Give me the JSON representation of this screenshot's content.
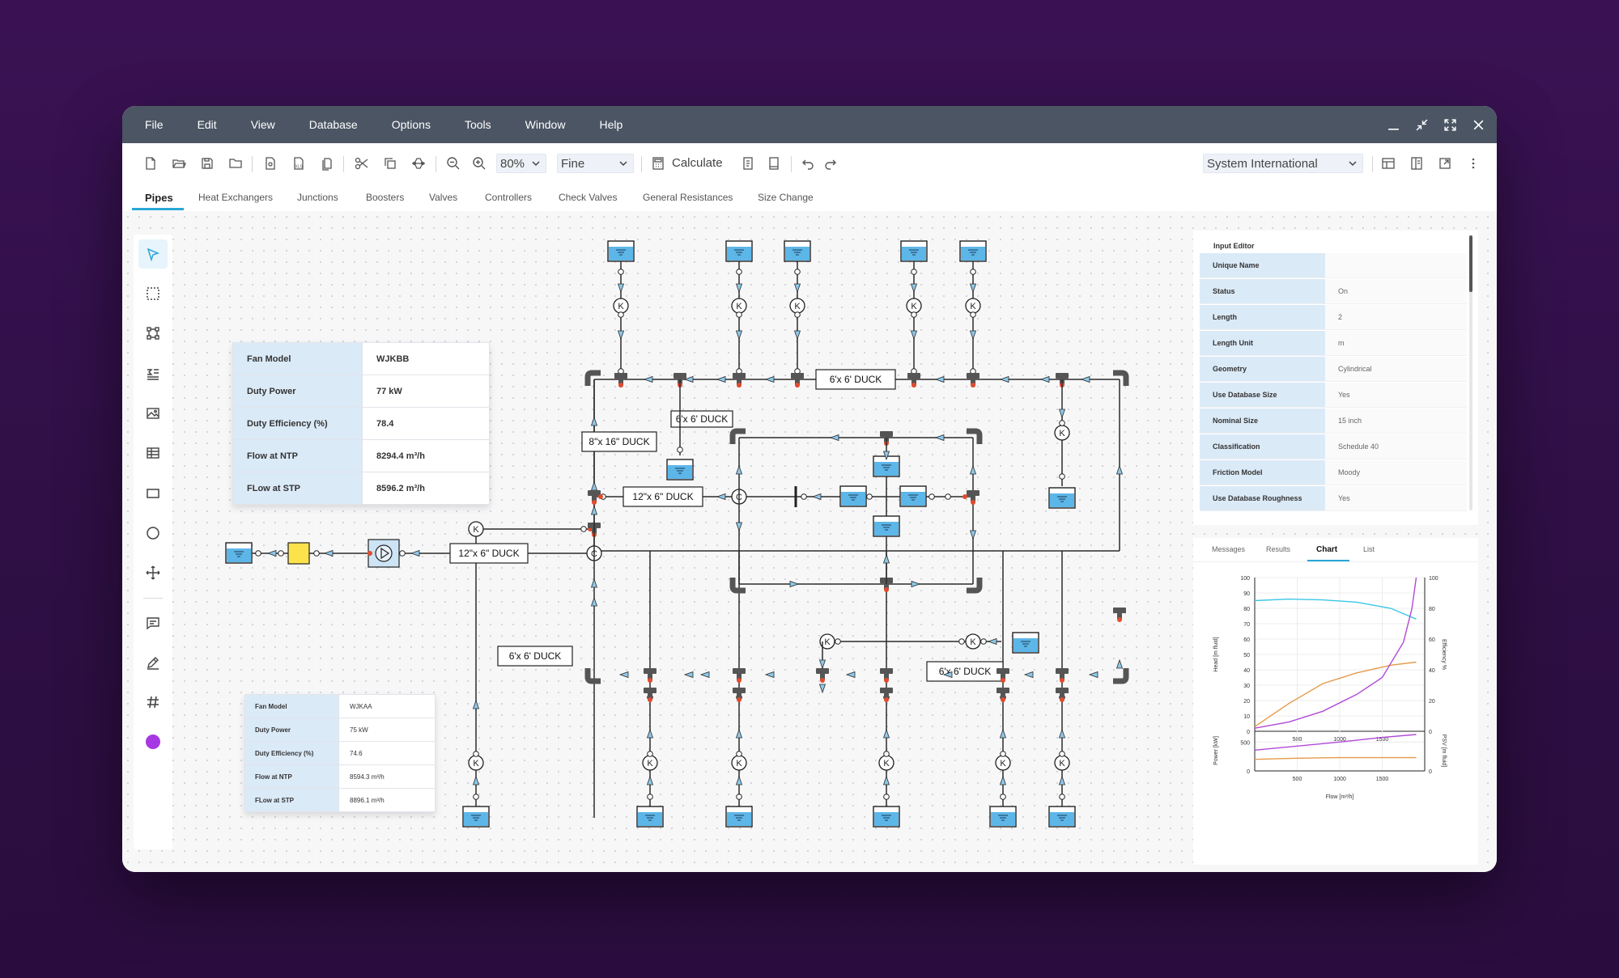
{
  "menu": [
    "File",
    "Edit",
    "View",
    "Database",
    "Options",
    "Tools",
    "Window",
    "Help"
  ],
  "toolbar": {
    "zoom": "80%",
    "mesh": "Fine",
    "calculate_label": "Calculate",
    "units": "System International"
  },
  "tabs": [
    "Pipes",
    "Heat Exchangers",
    "Junctions",
    "Boosters",
    "Valves",
    "Controllers",
    "Check Valves",
    "General Resistances",
    "Size Change"
  ],
  "fan_table_1": [
    {
      "k": "Fan Model",
      "v": "WJKBB"
    },
    {
      "k": "Duty Power",
      "v": "77 kW"
    },
    {
      "k": "Duty Efficiency (%)",
      "v": "78.4"
    },
    {
      "k": "Flow at NTP",
      "v": "8294.4 m³/h"
    },
    {
      "k": "FLow at STP",
      "v": "8596.2 m³/h"
    }
  ],
  "fan_table_2": [
    {
      "k": "Fan Model",
      "v": "WJKAA"
    },
    {
      "k": "Duty Power",
      "v": "75 kW"
    },
    {
      "k": "Duty Efficiency (%)",
      "v": "74.6"
    },
    {
      "k": "Flow at NTP",
      "v": "8594.3 m³/h"
    },
    {
      "k": "FLow at STP",
      "v": "8896.1 m³/h"
    }
  ],
  "diagram": {
    "labels": [
      "6'x 6' DUCK",
      "8\"x 16\" DUCK",
      "6'x 6' DUCK",
      "12\"x 6\" DUCK",
      "12\"x 6\" DUCK",
      "6'x 6' DUCK",
      "6'x 6' DUCK"
    ],
    "valve_letter": "K",
    "node_letter": "C"
  },
  "input_editor": {
    "title": "Input Editor",
    "rows": [
      {
        "k": "Unique Name",
        "v": ""
      },
      {
        "k": "Status",
        "v": "On"
      },
      {
        "k": "Length",
        "v": "2"
      },
      {
        "k": "Length Unit",
        "v": "m"
      },
      {
        "k": "Geometry",
        "v": "Cylindrical"
      },
      {
        "k": "Use Database Size",
        "v": "Yes"
      },
      {
        "k": "Nominal Size",
        "v": "15 inch"
      },
      {
        "k": "Classification",
        "v": "Schedule 40"
      },
      {
        "k": "Friction Model",
        "v": "Moody"
      },
      {
        "k": "Use Database Roughness",
        "v": "Yes"
      }
    ]
  },
  "chart_panel": {
    "tabs": [
      "Messages",
      "Results",
      "Chart",
      "List"
    ],
    "active_tab": "Chart"
  },
  "chart_data": [
    {
      "type": "line",
      "ylabel": "Head [m fluid]",
      "y2label": "Efficiency %",
      "ylim": [
        0,
        100
      ],
      "y2lim": [
        0,
        100
      ],
      "y_ticks": [
        0,
        10,
        20,
        30,
        40,
        50,
        60,
        70,
        80,
        90,
        100
      ],
      "y2_ticks": [
        0,
        20,
        40,
        60,
        80,
        100
      ],
      "x_ticks": [
        500,
        1000,
        1500
      ],
      "xlim": [
        0,
        2000
      ],
      "series": [
        {
          "color": "#3cc6e6",
          "x": [
            0,
            400,
            800,
            1200,
            1600,
            1900
          ],
          "y": [
            85,
            86,
            85.5,
            84,
            80,
            73
          ]
        },
        {
          "color": "#e69a4c",
          "x": [
            0,
            400,
            800,
            1200,
            1600,
            1900
          ],
          "y": [
            3,
            18,
            31,
            38,
            43,
            45
          ]
        },
        {
          "color": "#b04ad6",
          "x": [
            0,
            400,
            800,
            1200,
            1500,
            1750,
            1850,
            1900
          ],
          "y": [
            2,
            6,
            13,
            24,
            35,
            58,
            80,
            100
          ]
        }
      ],
      "grid": true
    },
    {
      "type": "line",
      "ylabel": "Power [kW]",
      "y2label": "PSV [m fluid]",
      "y_ticks": [
        0,
        500
      ],
      "y2_ticks": [
        0
      ],
      "x_ticks": [
        500,
        1000,
        1500
      ],
      "xlabel": "Flow [m³/h]",
      "xlim": [
        0,
        2000
      ],
      "ylim": [
        0,
        700
      ],
      "series": [
        {
          "color": "#b04ad6",
          "x": [
            0,
            500,
            1000,
            1500,
            1900
          ],
          "y": [
            360,
            430,
            500,
            580,
            630
          ]
        },
        {
          "color": "#e69a4c",
          "x": [
            0,
            500,
            1000,
            1500,
            1900
          ],
          "y": [
            200,
            220,
            230,
            230,
            230
          ]
        }
      ],
      "grid": true
    }
  ]
}
